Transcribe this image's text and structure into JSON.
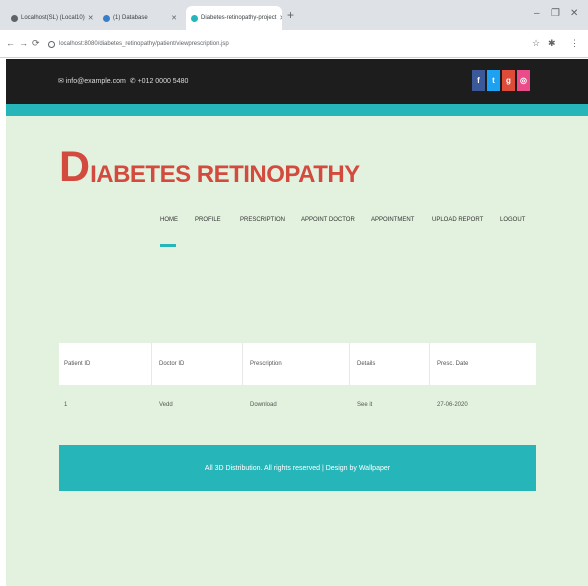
{
  "browser": {
    "tabs": [
      {
        "label": "Localhost(SL) (Local10)"
      },
      {
        "label": "(1) Database"
      },
      {
        "label": "Diabetes-retinopathy-project"
      }
    ],
    "new_tab": "+",
    "window_controls": [
      "–",
      "❐",
      "✕"
    ],
    "nav": {
      "back": "←",
      "forward": "→",
      "reload": "⟳"
    },
    "url": "localhost:8080/diabetes_retinopathy/patient/viewprescription.jsp",
    "toolbar_icons": [
      "☆",
      "✱",
      "⋮"
    ]
  },
  "topbar": {
    "email": "info@example.com",
    "phone": "+012 0000 5480",
    "social": [
      {
        "icon": "facebook-icon",
        "glyph": "f",
        "color": "#3b5998"
      },
      {
        "icon": "twitter-icon",
        "glyph": "t",
        "color": "#1da1f2"
      },
      {
        "icon": "google-plus-icon",
        "glyph": "g",
        "color": "#dd4b39"
      },
      {
        "icon": "dribbble-icon",
        "glyph": "◎",
        "color": "#ea4c89"
      }
    ]
  },
  "logo": {
    "initial": "D",
    "rest": "IABETES RETINOPATHY"
  },
  "nav": {
    "items": [
      {
        "label": "HOME"
      },
      {
        "label": "PROFILE"
      },
      {
        "label": "PRESCRIPTION"
      },
      {
        "label": "APPOINT DOCTOR"
      },
      {
        "label": "APPOINTMENT"
      },
      {
        "label": "UPLOAD REPORT"
      },
      {
        "label": "LOGOUT"
      }
    ]
  },
  "table": {
    "headers": [
      "Patient ID",
      "Doctor ID",
      "Prescription",
      "Details",
      "Presc. Date"
    ],
    "rows": [
      [
        "1",
        "Vedd",
        "Download",
        "See it",
        "27-06-2020"
      ]
    ]
  },
  "footer": {
    "text": "All 3D Distribution. All rights reserved | Design by Wallpaper"
  },
  "colors": {
    "accent": "#26b5b8",
    "logo": "#d34a3e",
    "page_bg": "#e3f2df",
    "topbar": "#1d1d1d"
  }
}
